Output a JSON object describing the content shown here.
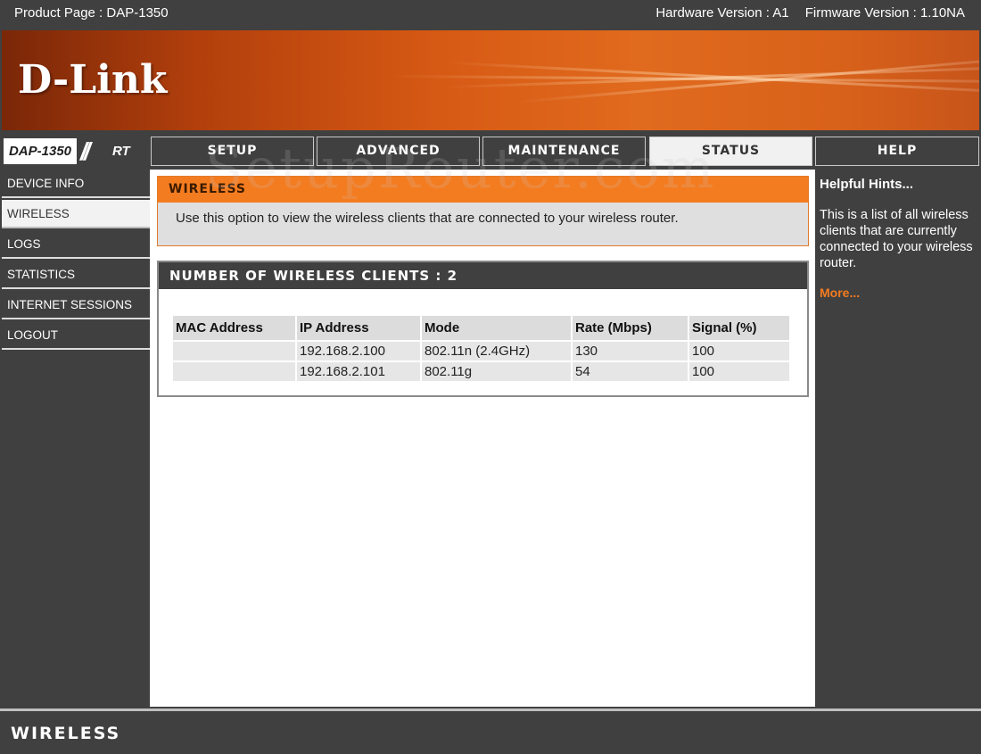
{
  "topbar": {
    "product": "Product Page : DAP-1350",
    "hardware": "Hardware Version : A1",
    "firmware": "Firmware Version : 1.10NA"
  },
  "brand": {
    "logo": "D-Link",
    "accent": "#f47c20"
  },
  "model": {
    "name": "DAP-1350",
    "slashes": "//",
    "suffix": "RT"
  },
  "tabs": [
    "SETUP",
    "ADVANCED",
    "MAINTENANCE",
    "STATUS",
    "HELP"
  ],
  "active_tab": "STATUS",
  "sidebar": {
    "items": [
      "DEVICE INFO",
      "WIRELESS",
      "LOGS",
      "STATISTICS",
      "INTERNET SESSIONS",
      "LOGOUT"
    ],
    "active": "WIRELESS"
  },
  "wireless_box": {
    "title": "WIRELESS",
    "description": "Use this option to view the wireless clients that are connected to your wireless router."
  },
  "clients_box": {
    "title": "NUMBER OF WIRELESS CLIENTS  :  2",
    "columns": [
      "MAC Address",
      "IP Address",
      "Mode",
      "Rate (Mbps)",
      "Signal (%)"
    ],
    "rows": [
      [
        "",
        "192.168.2.100",
        "802.11n (2.4GHz)",
        "130",
        "100"
      ],
      [
        "",
        "192.168.2.101",
        "802.11g",
        "54",
        "100"
      ]
    ]
  },
  "help": {
    "title": "Helpful Hints...",
    "text": "This is a list of all wireless clients that are currently connected to your wireless router.",
    "more": "More..."
  },
  "footer": {
    "label": "WIRELESS"
  },
  "watermark": "SetupRouter.com"
}
